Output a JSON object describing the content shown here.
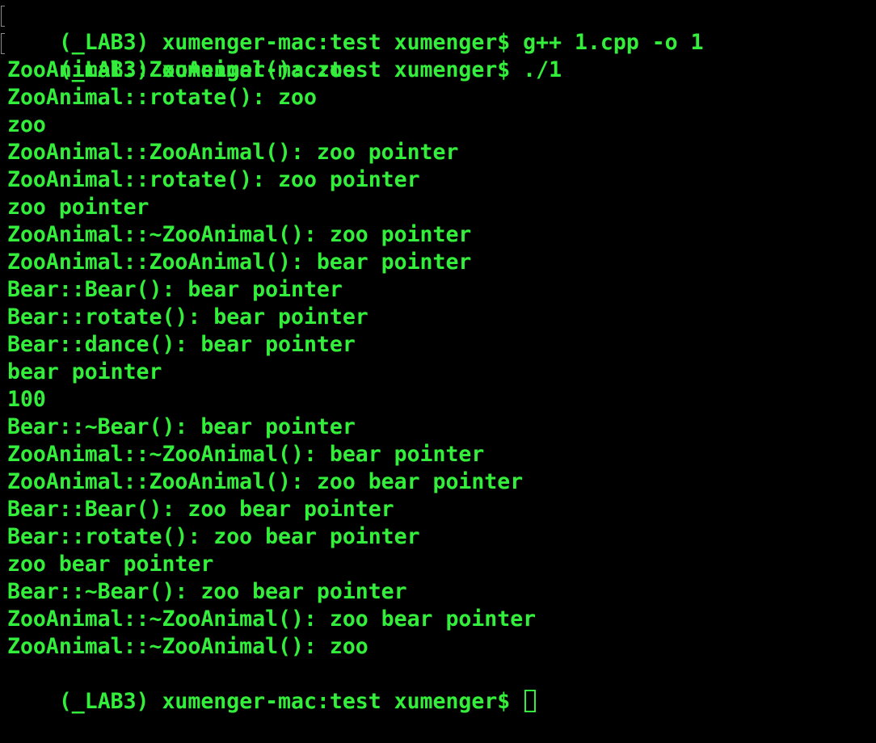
{
  "terminal": {
    "text_color": "#34ee3c",
    "background": "#000000",
    "lines": [
      "(_LAB3) xumenger-mac:test xumenger$ g++ 1.cpp -o 1",
      "(_LAB3) xumenger-mac:test xumenger$ ./1",
      "ZooAnimal::ZooAnimal(): zoo",
      "ZooAnimal::rotate(): zoo",
      "zoo",
      "ZooAnimal::ZooAnimal(): zoo pointer",
      "ZooAnimal::rotate(): zoo pointer",
      "zoo pointer",
      "ZooAnimal::~ZooAnimal(): zoo pointer",
      "ZooAnimal::ZooAnimal(): bear pointer",
      "Bear::Bear(): bear pointer",
      "Bear::rotate(): bear pointer",
      "Bear::dance(): bear pointer",
      "bear pointer",
      "100",
      "Bear::~Bear(): bear pointer",
      "ZooAnimal::~ZooAnimal(): bear pointer",
      "ZooAnimal::ZooAnimal(): zoo bear pointer",
      "Bear::Bear(): zoo bear pointer",
      "Bear::rotate(): zoo bear pointer",
      "zoo bear pointer",
      "Bear::~Bear(): zoo bear pointer",
      "ZooAnimal::~ZooAnimal(): zoo bear pointer",
      "ZooAnimal::~ZooAnimal(): zoo"
    ],
    "prompt": "(_LAB3) xumenger-mac:test xumenger$ "
  }
}
